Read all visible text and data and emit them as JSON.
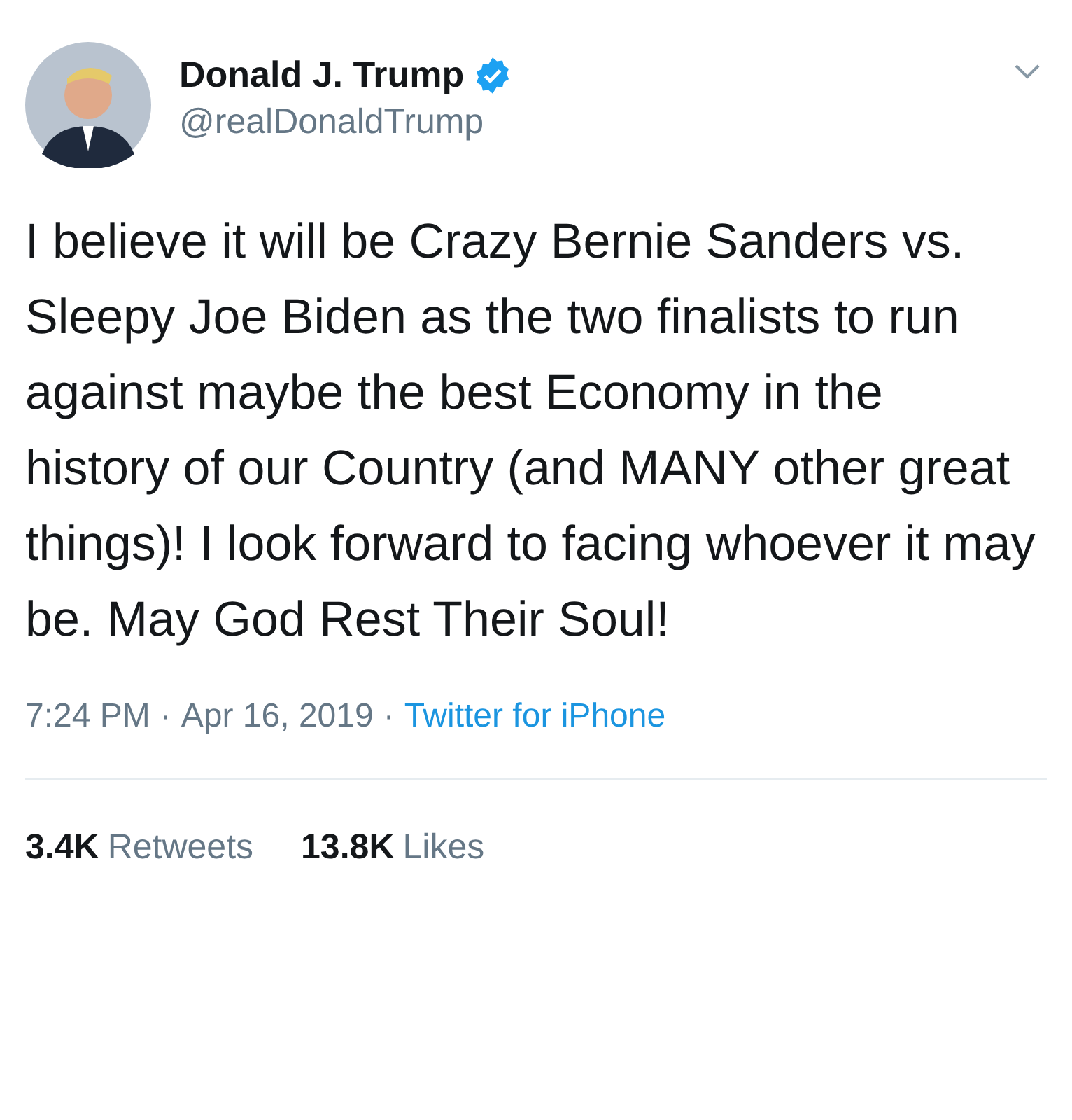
{
  "tweet": {
    "author": {
      "name": "Donald J. Trump",
      "verified": true,
      "handle": "@realDonaldTrump"
    },
    "text": "I believe it will be Crazy Bernie Sanders vs. Sleepy Joe Biden as the two finalists to run against maybe the best Economy in the history of our Country (and MANY other great things)! I look forward to facing whoever it may be. May God Rest Their Soul!",
    "meta": [
      {
        "kind": "plain",
        "text": "7:24 PM"
      },
      {
        "kind": "separator",
        "text": "·"
      },
      {
        "kind": "plain",
        "text": "Apr 16, 2019"
      },
      {
        "kind": "separator",
        "text": "·"
      },
      {
        "kind": "link",
        "text": "Twitter for iPhone"
      }
    ],
    "stats": [
      {
        "count": "3.4K",
        "label": "Retweets"
      },
      {
        "count": "13.8K",
        "label": "Likes"
      }
    ]
  }
}
